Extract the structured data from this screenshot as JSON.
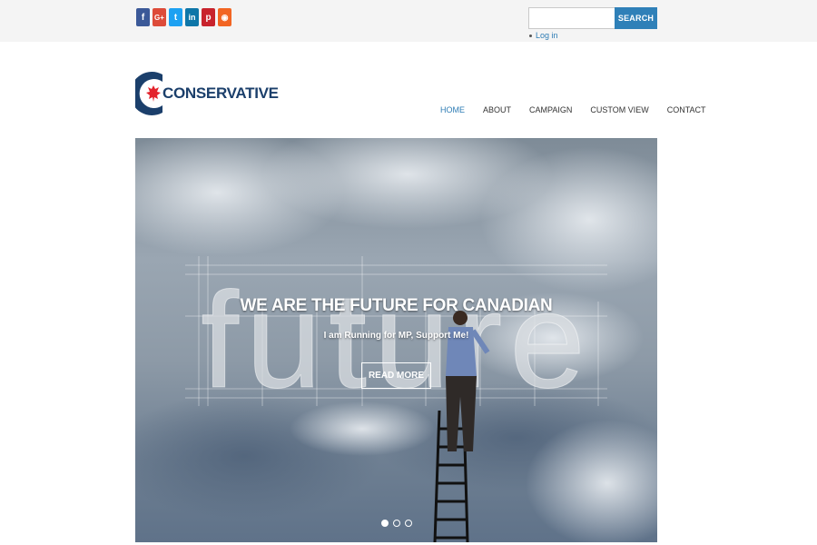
{
  "social": [
    {
      "icon": "facebook-icon",
      "glyph": "f",
      "color": "#3b5998"
    },
    {
      "icon": "google-plus-icon",
      "glyph": "G+",
      "color": "#dd4b39"
    },
    {
      "icon": "twitter-icon",
      "glyph": "t",
      "color": "#1da1f2"
    },
    {
      "icon": "linkedin-icon",
      "glyph": "in",
      "color": "#0e76a8"
    },
    {
      "icon": "pinterest-icon",
      "glyph": "p",
      "color": "#c8232c"
    },
    {
      "icon": "rss-icon",
      "glyph": "◉",
      "color": "#f26522"
    }
  ],
  "search": {
    "placeholder": "",
    "button_label": "SEARCH"
  },
  "login": {
    "label": "Log in"
  },
  "logo": {
    "text": "CONSERVATIVE"
  },
  "nav": {
    "items": [
      {
        "label": "HOME",
        "active": true
      },
      {
        "label": "ABOUT",
        "active": false
      },
      {
        "label": "CAMPAIGN",
        "active": false
      },
      {
        "label": "CUSTOM VIEW",
        "active": false
      },
      {
        "label": "CONTACT",
        "active": false
      }
    ]
  },
  "hero": {
    "title": "WE ARE THE FUTURE FOR CANADIAN",
    "subtitle": "I am Running for MP, Support Me!",
    "button_label": "READ MORE",
    "background_word": "future",
    "slides": 3,
    "active_slide": 0
  },
  "colors": {
    "accent": "#2f80b8",
    "brand": "#1b3f6b",
    "maple": "#e3232c"
  }
}
